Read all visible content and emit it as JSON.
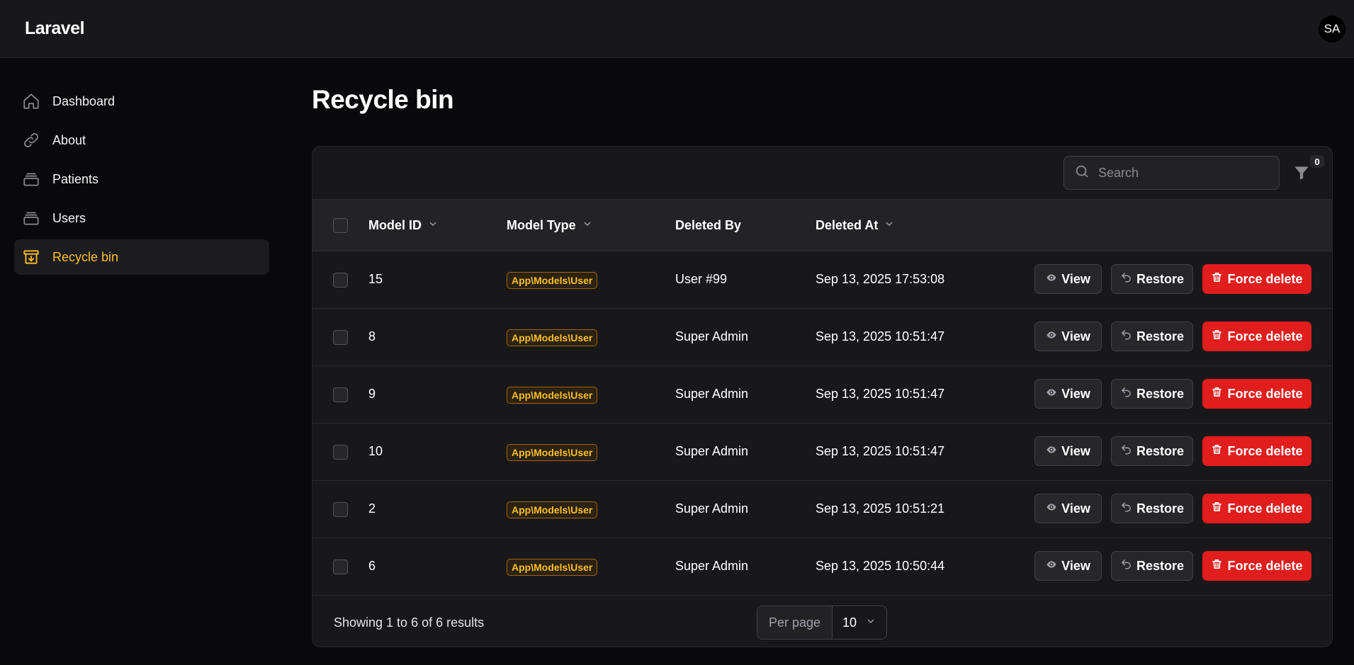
{
  "app": {
    "brand": "Laravel",
    "user_initials": "SA"
  },
  "sidebar": {
    "items": [
      {
        "label": "Dashboard",
        "icon": "home-icon"
      },
      {
        "label": "About",
        "icon": "link-icon"
      },
      {
        "label": "Patients",
        "icon": "stack-icon"
      },
      {
        "label": "Users",
        "icon": "stack-icon"
      },
      {
        "label": "Recycle bin",
        "icon": "archive-icon",
        "active": true
      }
    ]
  },
  "page": {
    "title": "Recycle bin"
  },
  "toolbar": {
    "search_placeholder": "Search",
    "filter_count": "0"
  },
  "table": {
    "columns": [
      "Model ID",
      "Model Type",
      "Deleted By",
      "Deleted At"
    ],
    "rows": [
      {
        "id": "15",
        "type": "App\\Models\\User",
        "deleted_by": "User #99",
        "deleted_at": "Sep 13, 2025 17:53:08"
      },
      {
        "id": "8",
        "type": "App\\Models\\User",
        "deleted_by": "Super Admin",
        "deleted_at": "Sep 13, 2025 10:51:47"
      },
      {
        "id": "9",
        "type": "App\\Models\\User",
        "deleted_by": "Super Admin",
        "deleted_at": "Sep 13, 2025 10:51:47"
      },
      {
        "id": "10",
        "type": "App\\Models\\User",
        "deleted_by": "Super Admin",
        "deleted_at": "Sep 13, 2025 10:51:47"
      },
      {
        "id": "2",
        "type": "App\\Models\\User",
        "deleted_by": "Super Admin",
        "deleted_at": "Sep 13, 2025 10:51:21"
      },
      {
        "id": "6",
        "type": "App\\Models\\User",
        "deleted_by": "Super Admin",
        "deleted_at": "Sep 13, 2025 10:50:44"
      }
    ],
    "actions": {
      "view": "View",
      "restore": "Restore",
      "force_delete": "Force delete"
    }
  },
  "footer": {
    "summary": "Showing 1 to 6 of 6 results",
    "per_page_label": "Per page",
    "per_page_value": "10"
  },
  "colors": {
    "accent": "#fbbf24",
    "danger": "#e11d1d",
    "background": "#09090b",
    "surface": "#18181b"
  }
}
